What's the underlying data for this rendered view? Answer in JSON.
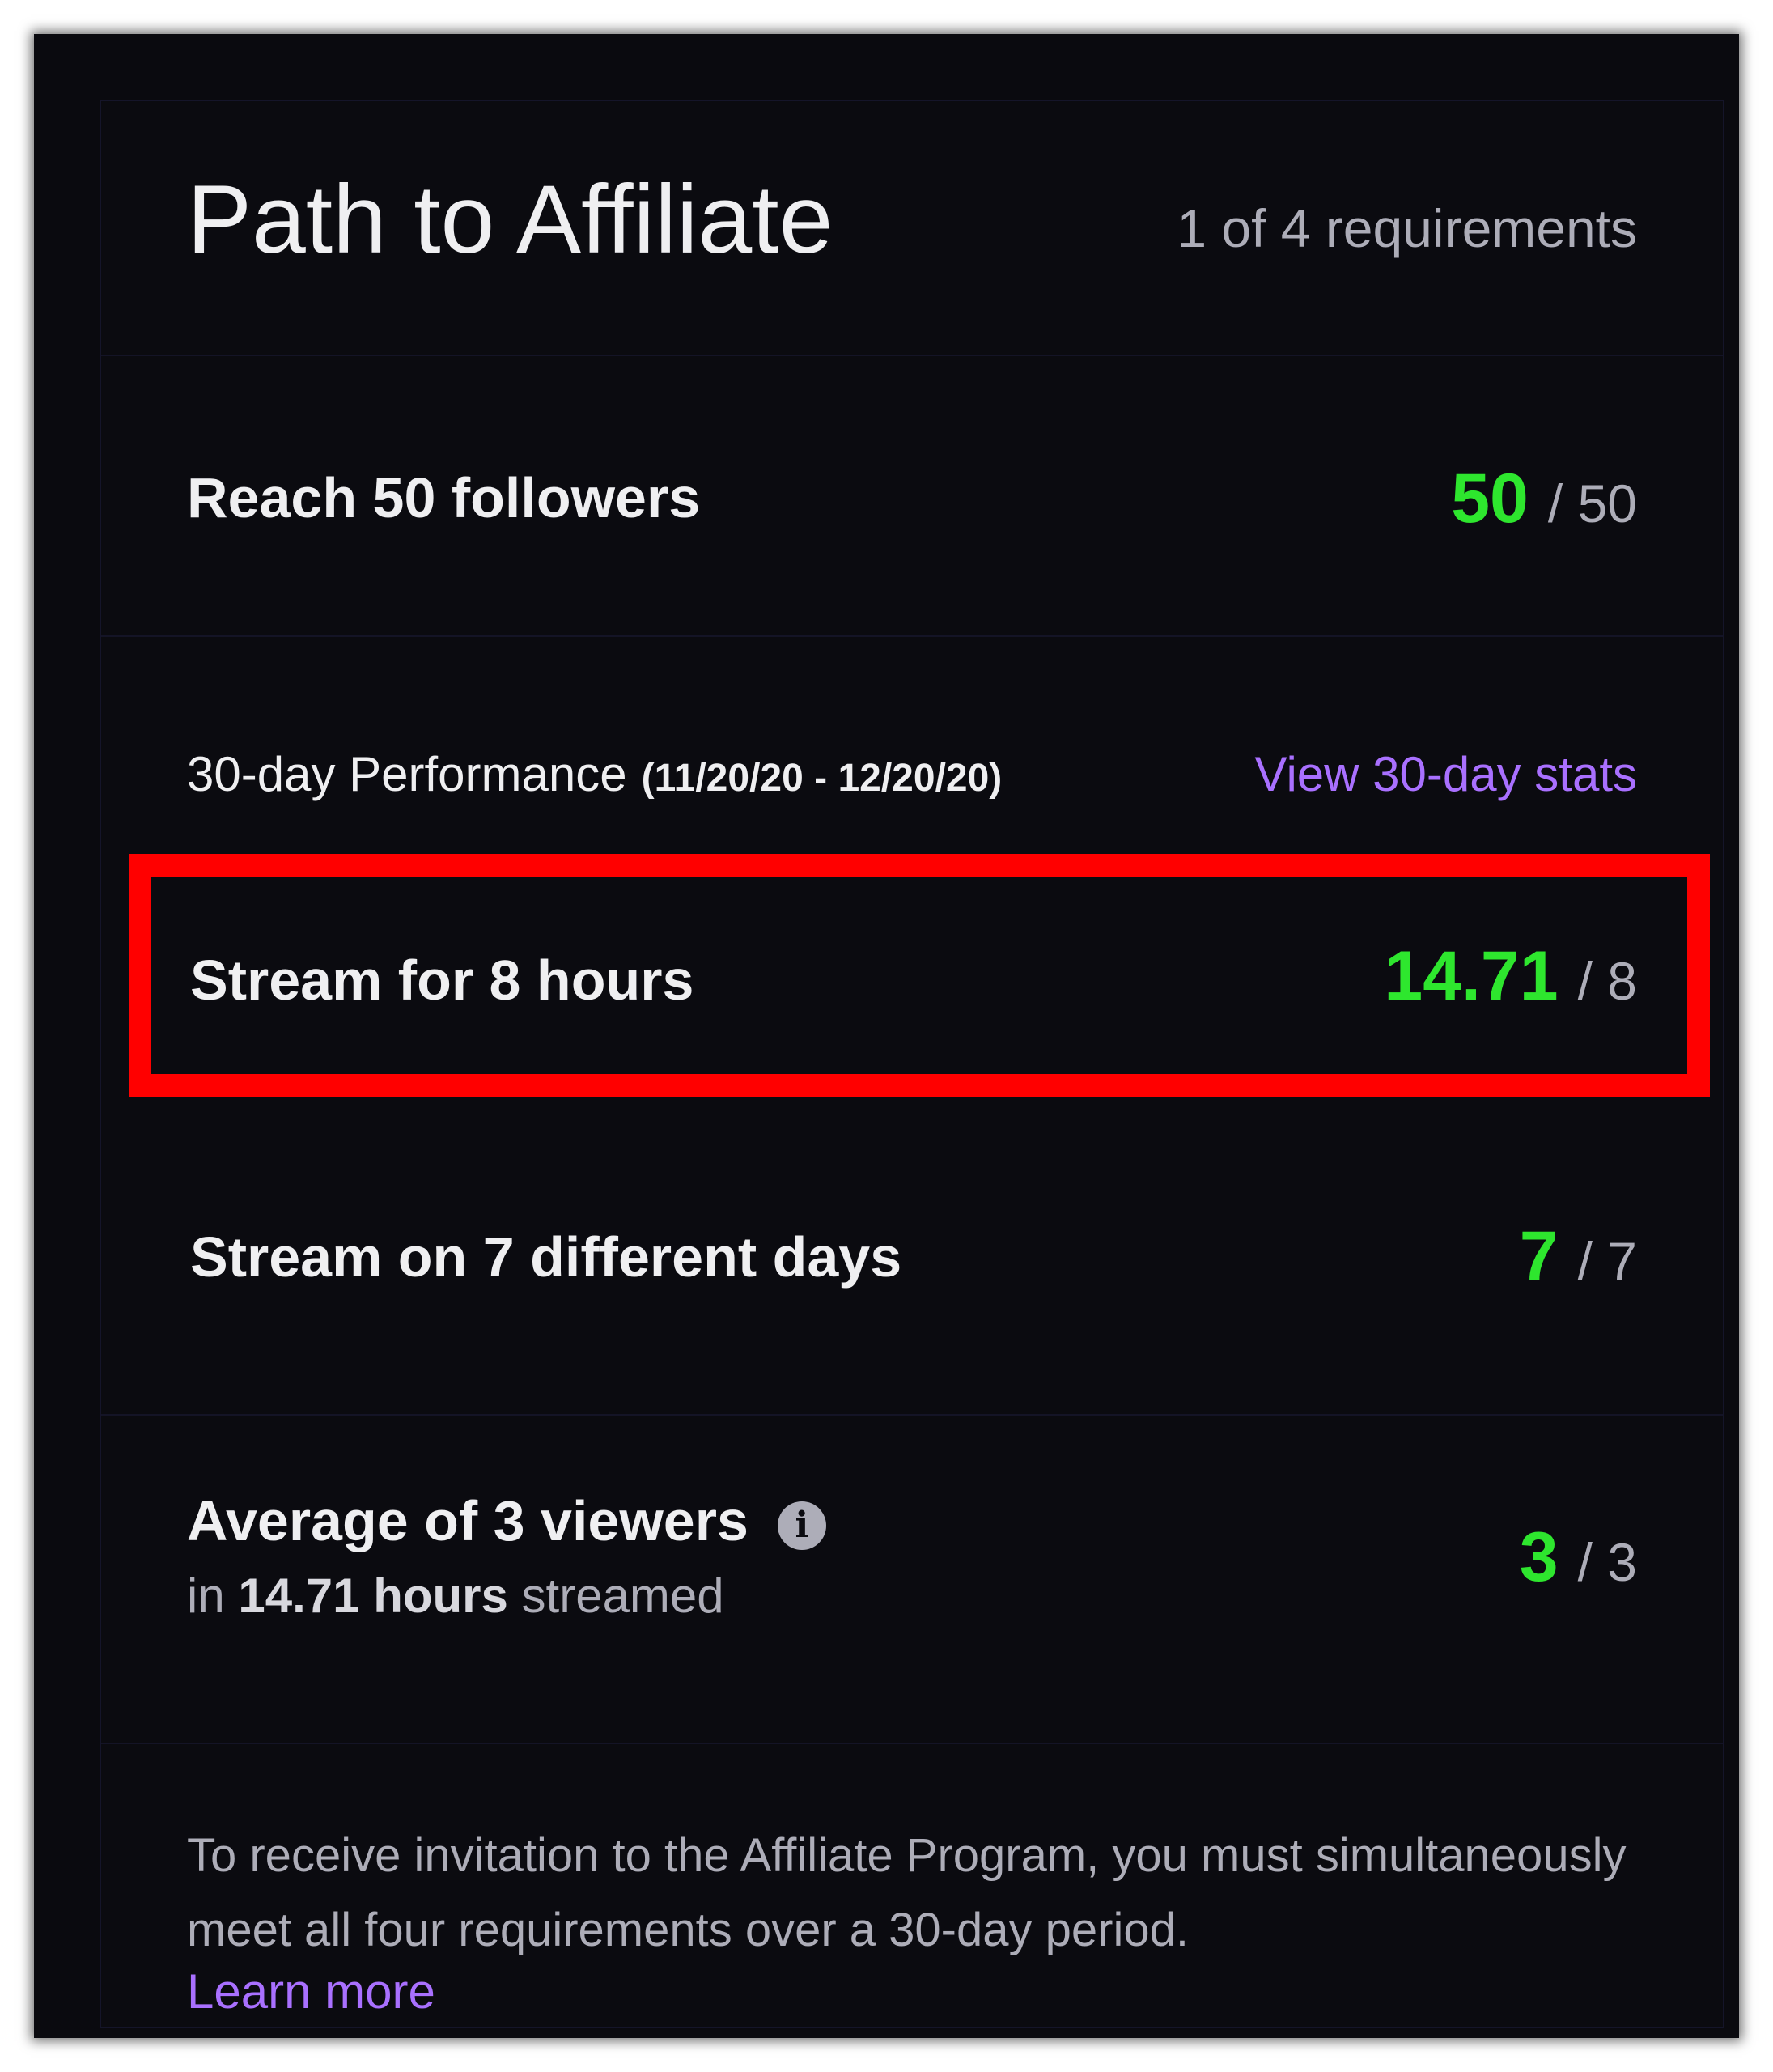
{
  "header": {
    "title": "Path to Affiliate",
    "requirements_count": "1 of 4 requirements"
  },
  "followers": {
    "label": "Reach 50 followers",
    "current": "50",
    "separator": "/",
    "target": "50"
  },
  "performance": {
    "title": "30-day Performance",
    "date_range": "(11/20/20 - 12/20/20)",
    "view_stats_link": "View 30-day stats",
    "requirements": [
      {
        "label": "Stream for 8 hours",
        "current": "14.71",
        "separator": "/",
        "target": "8"
      },
      {
        "label": "Stream on 7 different days",
        "current": "7",
        "separator": "/",
        "target": "7"
      },
      {
        "label": "Average of 3 viewers",
        "current": "3",
        "separator": "/",
        "target": "3",
        "info_icon": "info-icon",
        "sub_prefix": "in",
        "sub_hours": "14.71 hours",
        "sub_suffix": "streamed"
      }
    ]
  },
  "footer": {
    "text": "To receive invitation to the Affiliate Program, you must simultaneously meet all four requirements over a 30-day period.",
    "learn_more": "Learn more"
  },
  "colors": {
    "background": "#0b0b10",
    "accent": "#a970ff",
    "success": "#2ee62e",
    "highlight": "#ff0000",
    "text_primary": "#efeff1",
    "text_secondary": "#adadb8"
  }
}
